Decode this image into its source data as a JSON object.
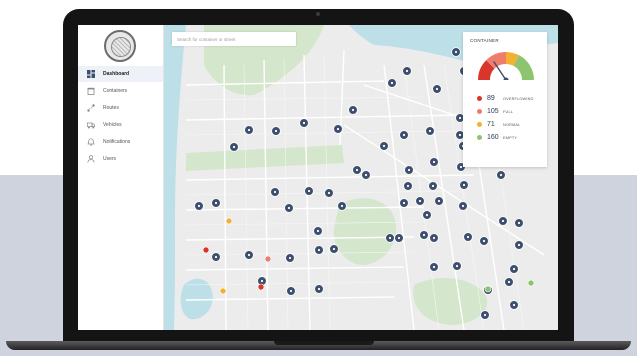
{
  "colors": {
    "overflowing": "#d8352b",
    "full": "#ef7d6c",
    "normal": "#f2b134",
    "empty": "#8cc470",
    "marker": "#3d4f6e",
    "water": "#bddfe8",
    "park": "#d4e6cb",
    "land": "#ececec"
  },
  "search": {
    "placeholder": "Search for container or street"
  },
  "sidebar": {
    "items": [
      {
        "label": "Dashboard",
        "icon": "dashboard-icon",
        "active": true
      },
      {
        "label": "Containers",
        "icon": "container-icon",
        "active": false
      },
      {
        "label": "Routes",
        "icon": "route-icon",
        "active": false
      },
      {
        "label": "Vehicles",
        "icon": "truck-icon",
        "active": false
      },
      {
        "label": "Notifications",
        "icon": "bell-icon",
        "active": false
      },
      {
        "label": "Users",
        "icon": "user-icon",
        "active": false
      }
    ]
  },
  "panel": {
    "title": "CONTAINER",
    "legend": [
      {
        "count": "89",
        "label": "OVERFLOWING",
        "color": "#d8352b"
      },
      {
        "count": "105",
        "label": "FULL",
        "color": "#ef7d6c"
      },
      {
        "count": "71",
        "label": "NORMAL",
        "color": "#f2b134"
      },
      {
        "count": "160",
        "label": "EMPTY",
        "color": "#8cc470"
      }
    ]
  }
}
